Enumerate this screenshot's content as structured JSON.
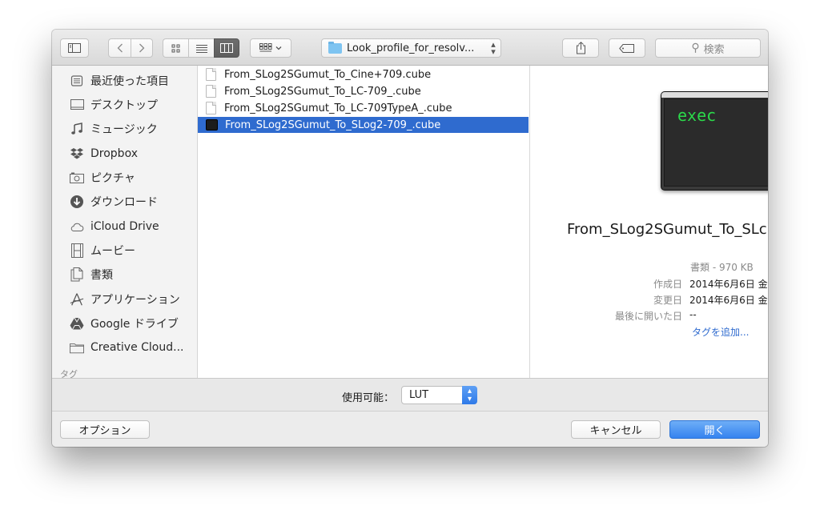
{
  "toolbar": {
    "path_folder": "Look_profile_for_resolv...",
    "search_placeholder": "検索",
    "search_glyph": "⚲"
  },
  "sidebar": {
    "items": [
      {
        "label": "最近使った項目",
        "icon": "recents-icon"
      },
      {
        "label": "デスクトップ",
        "icon": "desktop-icon"
      },
      {
        "label": "ミュージック",
        "icon": "music-icon"
      },
      {
        "label": "Dropbox",
        "icon": "dropbox-icon"
      },
      {
        "label": "ピクチャ",
        "icon": "camera-icon"
      },
      {
        "label": "ダウンロード",
        "icon": "download-icon"
      },
      {
        "label": "iCloud Drive",
        "icon": "cloud-icon"
      },
      {
        "label": "ムービー",
        "icon": "film-icon"
      },
      {
        "label": "書類",
        "icon": "documents-icon"
      },
      {
        "label": "アプリケーション",
        "icon": "applications-icon"
      },
      {
        "label": "Google ドライブ",
        "icon": "google-drive-icon"
      },
      {
        "label": "Creative Cloud...",
        "icon": "folder-icon"
      }
    ],
    "section_heading": "タグ"
  },
  "files": [
    {
      "name": "From_SLog2SGumut_To_Cine+709.cube",
      "selected": false
    },
    {
      "name": "From_SLog2SGumut_To_LC-709_.cube",
      "selected": false
    },
    {
      "name": "From_SLog2SGumut_To_LC-709TypeA_.cube",
      "selected": false
    },
    {
      "name": "From_SLog2SGumut_To_SLog2-709_.cube",
      "selected": true
    }
  ],
  "preview": {
    "thumb_text": "exec",
    "name": "From_SLog2SGumut_To_SLc",
    "kind": "書類 - 970 KB",
    "created_label": "作成日",
    "created_value": "2014年6月6日 金",
    "modified_label": "変更日",
    "modified_value": "2014年6月6日 金",
    "last_opened_label": "最後に開いた日",
    "last_opened_value": "--",
    "add_tags": "タグを追加..."
  },
  "filter": {
    "label": "使用可能：",
    "value": "LUT"
  },
  "buttons": {
    "options": "オプション",
    "cancel": "キャンセル",
    "open": "開く"
  },
  "colors": {
    "selection": "#2f6bcf",
    "primary_button": "#3583ef",
    "exec_text": "#2bd94a"
  }
}
